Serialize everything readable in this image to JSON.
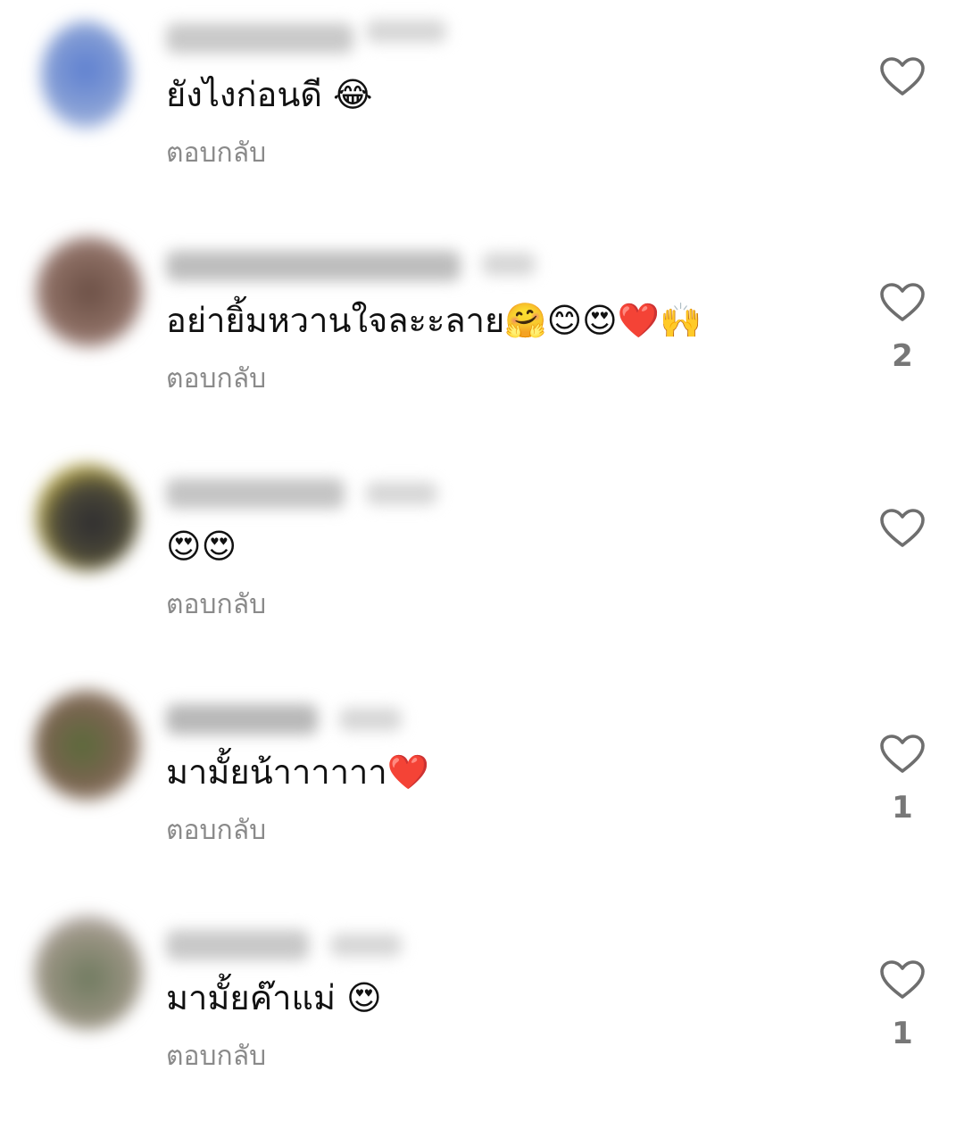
{
  "comments": [
    {
      "avatar_color": "#6b86c4",
      "username_color": "#c9c9c9",
      "text": "ยังไงก่อนดี 😂",
      "reply_label": "ตอบกลับ",
      "like_count": ""
    },
    {
      "avatar_color": "#7d5e52",
      "username_color": "#bdbdbd",
      "text": "อย่ายิ้มหวานใจละะลาย🤗😊😍❤️🙌",
      "reply_label": "ตอบกลับ",
      "like_count": "2"
    },
    {
      "avatar_color": "#4a4636",
      "username_color": "#c4c4c4",
      "text": "😍😍",
      "reply_label": "ตอบกลับ",
      "like_count": ""
    },
    {
      "avatar_color": "#6b6a4f",
      "username_color": "#b8b8b8",
      "text": "มามั้ยน้าาาาาา❤️",
      "reply_label": "ตอบกลับ",
      "like_count": "1"
    },
    {
      "avatar_color": "#8a8f7a",
      "username_color": "#c8c8c8",
      "text": "มามั้ยค๊าแม่ 😍",
      "reply_label": "ตอบกลับ",
      "like_count": "1"
    }
  ],
  "colors": {
    "like_icon_stroke": "#6e6e6e",
    "reply_text": "#8a8a8a",
    "comment_text": "#111111"
  }
}
